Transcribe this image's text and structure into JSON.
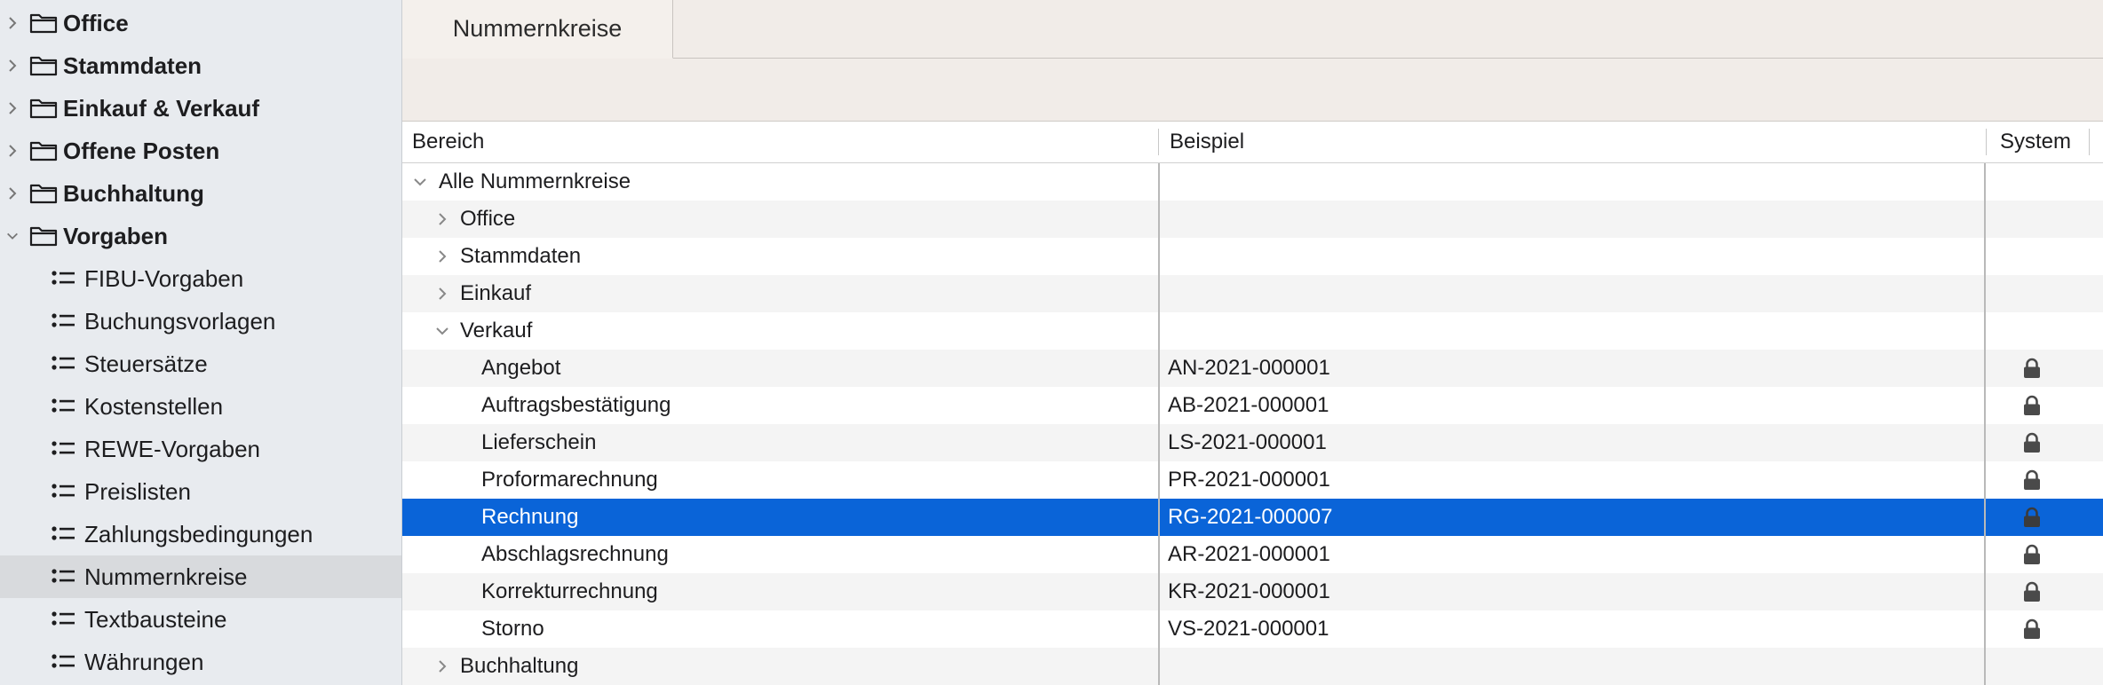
{
  "sidebar": {
    "groups": [
      {
        "label": "Office",
        "expanded": false
      },
      {
        "label": "Stammdaten",
        "expanded": false
      },
      {
        "label": "Einkauf & Verkauf",
        "expanded": false
      },
      {
        "label": "Offene Posten",
        "expanded": false
      },
      {
        "label": "Buchhaltung",
        "expanded": false
      },
      {
        "label": "Vorgaben",
        "expanded": true
      }
    ],
    "vorgaben_items": [
      {
        "label": "FIBU-Vorgaben"
      },
      {
        "label": "Buchungsvorlagen"
      },
      {
        "label": "Steuersätze"
      },
      {
        "label": "Kostenstellen"
      },
      {
        "label": "REWE-Vorgaben"
      },
      {
        "label": "Preislisten"
      },
      {
        "label": "Zahlungsbedingungen"
      },
      {
        "label": "Nummernkreise",
        "selected": true
      },
      {
        "label": "Textbausteine"
      },
      {
        "label": "Währungen"
      }
    ]
  },
  "tab": {
    "label": "Nummernkreise"
  },
  "table": {
    "headers": {
      "bereich": "Bereich",
      "beispiel": "Beispiel",
      "system": "System"
    },
    "root": "Alle Nummernkreise",
    "categories": {
      "office": "Office",
      "stammdaten": "Stammdaten",
      "einkauf": "Einkauf",
      "verkauf": "Verkauf",
      "buchhaltung": "Buchhaltung"
    },
    "verkauf_rows": [
      {
        "bereich": "Angebot",
        "beispiel": "AN-2021-000001",
        "system": true
      },
      {
        "bereich": "Auftragsbestätigung",
        "beispiel": "AB-2021-000001",
        "system": true
      },
      {
        "bereich": "Lieferschein",
        "beispiel": "LS-2021-000001",
        "system": true
      },
      {
        "bereich": "Proformarechnung",
        "beispiel": "PR-2021-000001",
        "system": true
      },
      {
        "bereich": "Rechnung",
        "beispiel": "RG-2021-000007",
        "system": true,
        "selected": true
      },
      {
        "bereich": "Abschlagsrechnung",
        "beispiel": "AR-2021-000001",
        "system": true
      },
      {
        "bereich": "Korrekturrechnung",
        "beispiel": "KR-2021-000001",
        "system": true
      },
      {
        "bereich": "Storno",
        "beispiel": "VS-2021-000001",
        "system": true
      }
    ]
  },
  "colors": {
    "selection": "#0a64d8",
    "sidebar_bg": "#e8ebef",
    "tabbar_bg": "#f1ece8"
  },
  "icons": {
    "group": "folder-icon",
    "item": "list-icon",
    "system": "lock-icon"
  }
}
